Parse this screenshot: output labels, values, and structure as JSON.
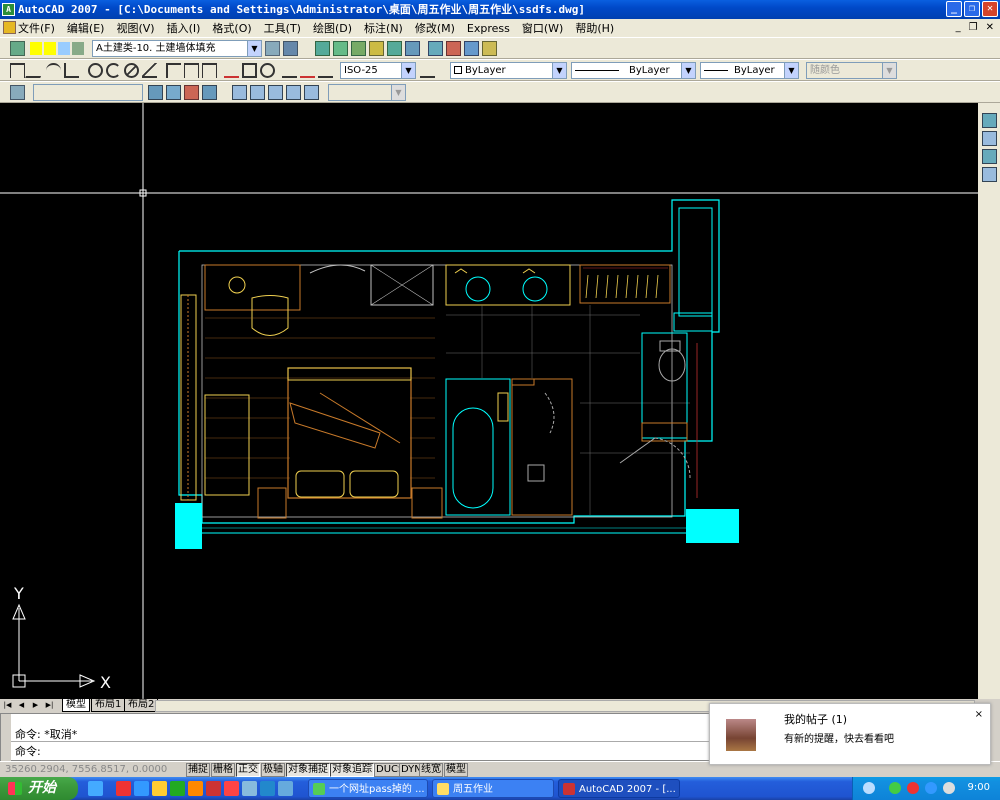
{
  "window": {
    "title": "AutoCAD 2007 - [C:\\Documents and Settings\\Administrator\\桌面\\周五作业\\周五作业\\ssdfs.dwg]"
  },
  "menu": [
    "文件(F)",
    "编辑(E)",
    "视图(V)",
    "插入(I)",
    "格式(O)",
    "工具(T)",
    "绘图(D)",
    "标注(N)",
    "修改(M)",
    "Express",
    "窗口(W)",
    "帮助(H)"
  ],
  "toolbars": {
    "layer_name": "A土建类-10. 土建墙体填充",
    "dim_style": "ISO-25",
    "color": "ByLayer",
    "linetype": "ByLayer",
    "lineweight": "ByLayer",
    "plot_style": "随颜色"
  },
  "ucs": {
    "x_label": "X",
    "y_label": "Y"
  },
  "tabs": {
    "model": "模型",
    "layout1": "布局1",
    "layout2": "布局2"
  },
  "command": {
    "line1": "命令: *取消*",
    "line2": "命令:"
  },
  "status": {
    "coords": "35260.2904, 7556.8517, 0.0000",
    "buttons": [
      "捕捉",
      "栅格",
      "正交",
      "极轴",
      "对象捕捉",
      "对象追踪",
      "DUCS",
      "DYN",
      "线宽",
      "模型"
    ]
  },
  "notification": {
    "title": "我的帖子 (1)",
    "text": "有新的提醒，快去看看吧",
    "close": "×"
  },
  "taskbar": {
    "start": "开始",
    "tasks": [
      "一个网址pass掉的 ...",
      "周五作业",
      "AutoCAD 2007 - [..."
    ],
    "clock": "9:00"
  },
  "colors": {
    "canvas": "#000000",
    "cyan": "#00ffff",
    "orange": "#c87a2a",
    "yellow": "#f0d050",
    "crosshair": "#ffffff"
  }
}
